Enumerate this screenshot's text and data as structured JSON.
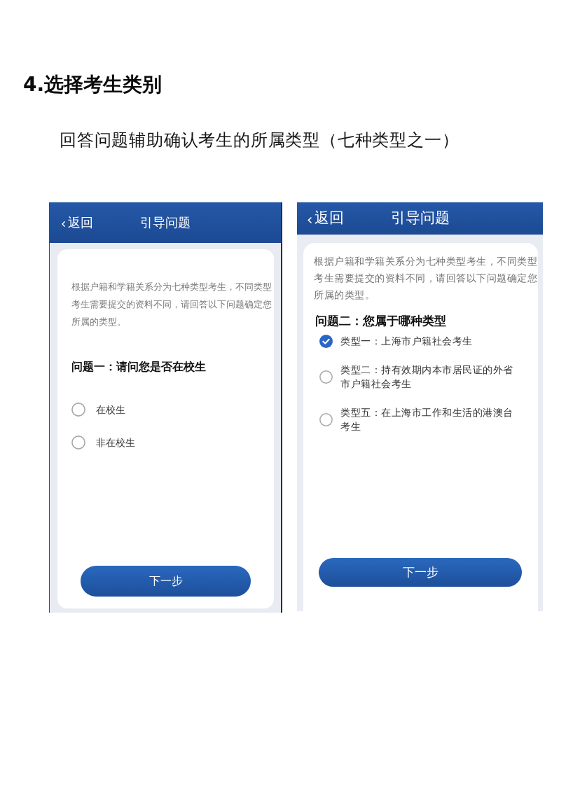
{
  "heading": "4.选择考生类别",
  "subtitle": "回答问题辅助确认考生的所属类型（七种类型之一）",
  "screens": [
    {
      "nav": {
        "back": "返回",
        "title": "引导问题"
      },
      "intro": "根据户籍和学籍关系分为七种类型考生，不同类型考生需要提交的资料不同，请回答以下问题确定您所属的类型。",
      "question": "问题一：请问您是否在校生",
      "options": [
        {
          "label": "在校生",
          "selected": false
        },
        {
          "label": "非在校生",
          "selected": false
        }
      ],
      "button": "下一步"
    },
    {
      "nav": {
        "back": "返回",
        "title": "引导问题"
      },
      "intro": "根据户籍和学籍关系分为七种类型考生，不同类型考生需要提交的资料不同，请回答以下问题确定您所属的类型。",
      "question": "问题二：您属于哪种类型",
      "options": [
        {
          "label": "类型一：上海市户籍社会考生",
          "selected": true
        },
        {
          "label": "类型二：持有效期内本市居民证的外省市户籍社会考生",
          "selected": false
        },
        {
          "label": "类型五：在上海市工作和生活的港澳台考生",
          "selected": false
        }
      ],
      "button": "下一步"
    }
  ]
}
